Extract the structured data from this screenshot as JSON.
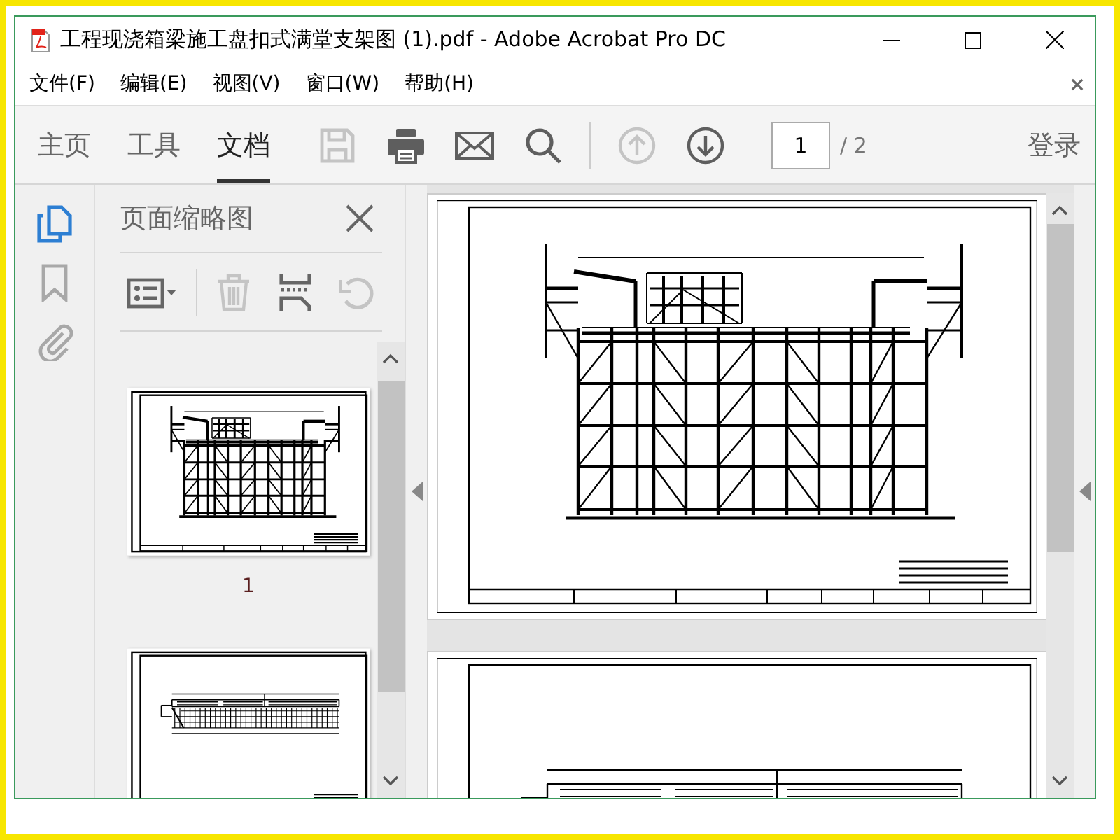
{
  "window": {
    "title": "工程现浇箱梁施工盘扣式满堂支架图 (1).pdf - Adobe Acrobat Pro DC"
  },
  "menu": [
    {
      "label": "文件(F)"
    },
    {
      "label": "编辑(E)"
    },
    {
      "label": "视图(V)"
    },
    {
      "label": "窗口(W)"
    },
    {
      "label": "帮助(H)"
    }
  ],
  "toolbar": {
    "tabs": [
      {
        "label": "主页",
        "selected": false
      },
      {
        "label": "工具",
        "selected": false
      },
      {
        "label": "文档",
        "selected": true
      }
    ],
    "tools": [
      {
        "kind": "save",
        "disabled": true
      },
      {
        "kind": "print",
        "disabled": false
      },
      {
        "kind": "mail",
        "disabled": false
      },
      {
        "kind": "search",
        "disabled": false
      },
      {
        "kind": "separator"
      },
      {
        "kind": "previous-page",
        "disabled": true
      },
      {
        "kind": "next-page",
        "disabled": false
      }
    ],
    "page_field": {
      "value": "1"
    },
    "page_total": "/ 2",
    "sign_in": "登录"
  },
  "side_rail": [
    {
      "kind": "pages",
      "selected": true
    },
    {
      "kind": "bookmarks",
      "selected": false
    },
    {
      "kind": "attachments",
      "selected": false
    }
  ],
  "panel": {
    "title": "页面缩略图",
    "tools": [
      {
        "kind": "options",
        "disabled": false
      },
      {
        "kind": "separator"
      },
      {
        "kind": "delete",
        "disabled": true
      },
      {
        "kind": "insert",
        "disabled": false
      },
      {
        "kind": "rotate",
        "disabled": true
      }
    ],
    "thumbnails": [
      {
        "kind": "elevation",
        "label": "1"
      },
      {
        "kind": "plan"
      }
    ]
  },
  "document": {
    "pages": [
      {
        "kind": "elevation"
      },
      {
        "kind": "plan"
      }
    ]
  }
}
